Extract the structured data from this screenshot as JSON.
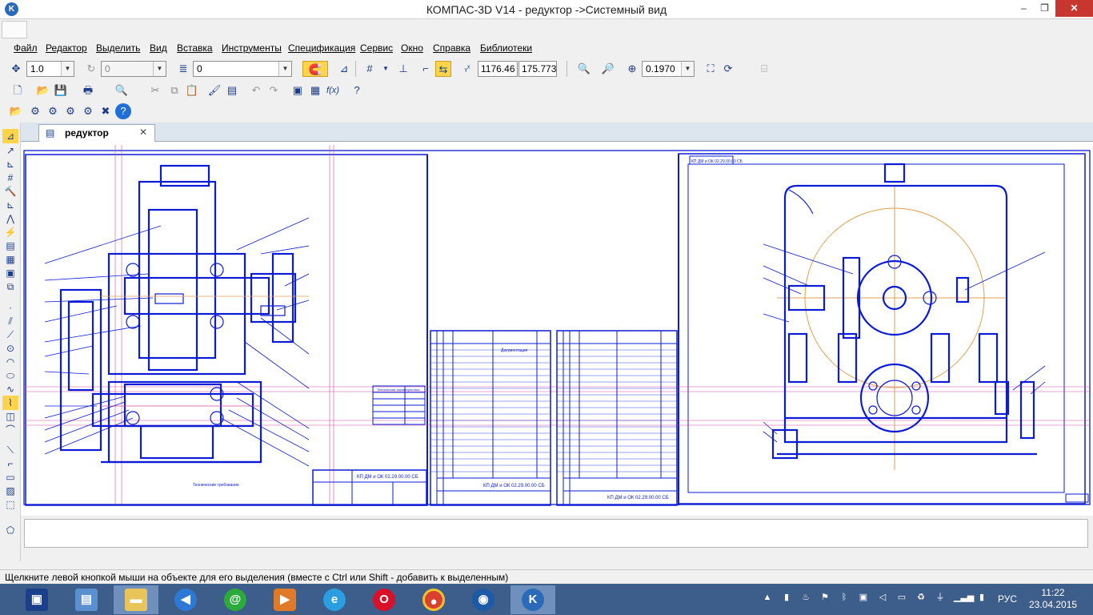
{
  "window": {
    "title": "КОМПАС-3D V14 - редуктор ->Системный вид",
    "app_icon": "kompas-logo-icon",
    "buttons": {
      "minimize": "–",
      "restore": "❐",
      "close": "✕"
    }
  },
  "menu": [
    "Файл",
    "Редактор",
    "Выделить",
    "Вид",
    "Вставка",
    "Инструменты",
    "Спецификация",
    "Сервис",
    "Окно",
    "Справка",
    "Библиотеки"
  ],
  "toolbar1": {
    "step_value": "1.0",
    "angle_value": "0",
    "layer_value": "0",
    "x_coord": "1176.46",
    "y_coord": "175.7730",
    "zoom_value": "0.1970"
  },
  "document": {
    "tab_label": "редуктор",
    "close_glyph": "✕"
  },
  "drawing": {
    "left_title": "КП ДМ и ОК 02.29.00.00 СБ",
    "mid_title": "КП ДМ и ОК 02.29.00.00 СБ",
    "right_title": "КП ДМ и ОК 02.29.00.00 СБ",
    "tech_table_header": "Техническая характеристика",
    "spec_section": "Документация",
    "notes": "Технические требования"
  },
  "status": {
    "hint": "Щелкните левой кнопкой мыши на объекте для его выделения (вместе с Ctrl или Shift - добавить к выделенным)"
  },
  "taskbar": {
    "apps": [
      "save-icon",
      "control-panel-icon",
      "file-explorer-icon",
      "media-player-icon",
      "qip-icon",
      "media-icon",
      "internet-explorer-icon",
      "opera-icon",
      "chrome-icon",
      "app-icon",
      "kompas-taskbar-icon"
    ],
    "lang": "РУС",
    "time": "11:22",
    "date": "23.04.2015"
  },
  "colors": {
    "drawing_line": "#0b1bd6",
    "dimension_line": "#e0a050",
    "axis_line": "#d84aa0",
    "taskbar": "#3d5d8a"
  }
}
